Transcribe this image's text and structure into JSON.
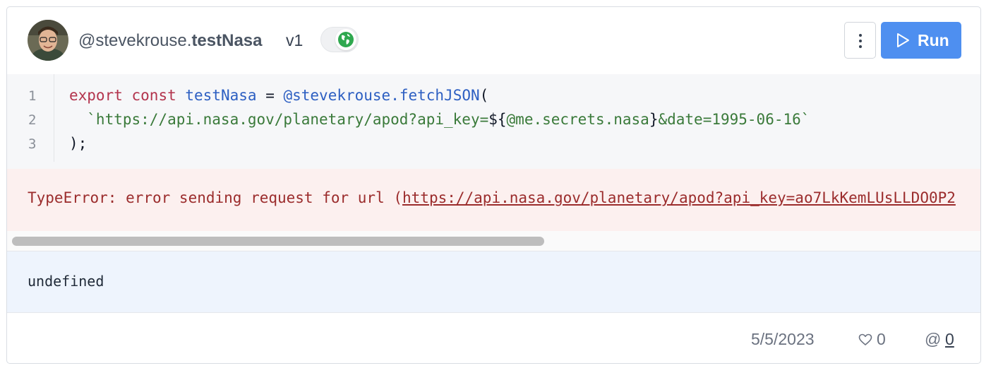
{
  "header": {
    "author_handle": "@stevekrouse.",
    "val_name": "testNasa",
    "version": "v1",
    "run_label": "Run"
  },
  "icons": {
    "avatar": "user-avatar",
    "visibility": "globe-icon",
    "menu": "more-vertical-icon",
    "run": "play-icon",
    "like": "heart-icon",
    "references": "at-icon"
  },
  "colors": {
    "accent": "#4e8ff0",
    "keyword": "#b3344d",
    "identifier": "#2d5fc2",
    "string": "#3a7a3a",
    "error_text": "#9b2c2c",
    "error_bg": "#fcf0ef",
    "result_bg": "#eef4fd",
    "globe": "#2fa84f"
  },
  "code": {
    "lines": [
      {
        "number": "1",
        "kw1": "export",
        "kw2": "const",
        "ident": "testNasa",
        "op": " = ",
        "call": "@stevekrouse.fetchJSON",
        "open": "("
      },
      {
        "number": "2",
        "str_start": "  `https://api.nasa.gov/planetary/apod?api_key=",
        "interp_open": "${",
        "interp_ref": "@me.secrets.nasa",
        "interp_close": "}",
        "str_end": "&date=1995-06-16`"
      },
      {
        "number": "3",
        "close": ");"
      }
    ]
  },
  "error": {
    "prefix": "TypeError: error sending request for url (",
    "url": "https://api.nasa.gov/planetary/apod?api_key=ao7LkKemLUsLLDO0P2"
  },
  "result": {
    "value": "undefined"
  },
  "footer": {
    "date": "5/5/2023",
    "likes": "0",
    "references": "0"
  }
}
